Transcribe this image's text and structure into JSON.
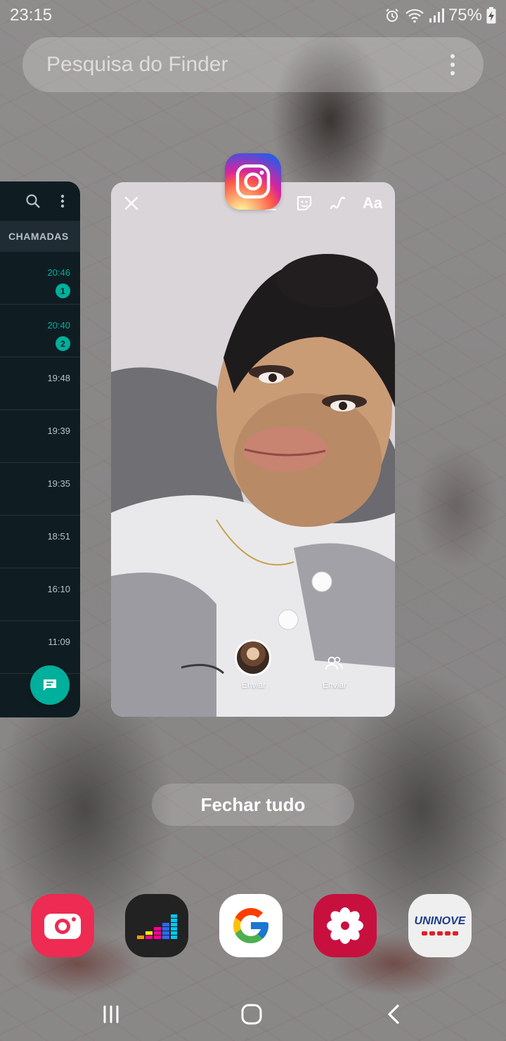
{
  "status_bar": {
    "time": "23:15",
    "battery": "75%"
  },
  "search": {
    "placeholder": "Pesquisa do Finder"
  },
  "left_app": {
    "tab_label": "CHAMADAS",
    "rows": [
      {
        "time": "20:46",
        "badge": "1",
        "highlight": true
      },
      {
        "time": "20:40",
        "badge": "2",
        "highlight": true
      },
      {
        "time": "19:48",
        "badge": "",
        "highlight": false
      },
      {
        "time": "19:39",
        "badge": "",
        "highlight": false
      },
      {
        "time": "19:35",
        "badge": "",
        "highlight": false
      },
      {
        "time": "18:51",
        "badge": "",
        "highlight": false
      },
      {
        "time": "16:10",
        "badge": "",
        "highlight": false
      },
      {
        "time": "11:09",
        "badge": "",
        "highlight": false
      }
    ]
  },
  "main_app": {
    "tools": {
      "text_tool": "Aa"
    },
    "send_labels": [
      "Enviar",
      "Enviar"
    ]
  },
  "close_all": "Fechar tudo",
  "dock": {
    "apps": [
      "camera-app",
      "deezer-app",
      "google-app",
      "gallery-app",
      "uninove-app"
    ],
    "uninove_text": "UNINOVE"
  },
  "colors": {
    "whatsapp_dark": "#0f1d23",
    "whatsapp_green": "#00af9c",
    "camera_red": "#ee2b52",
    "gallery_red": "#c8103f"
  }
}
